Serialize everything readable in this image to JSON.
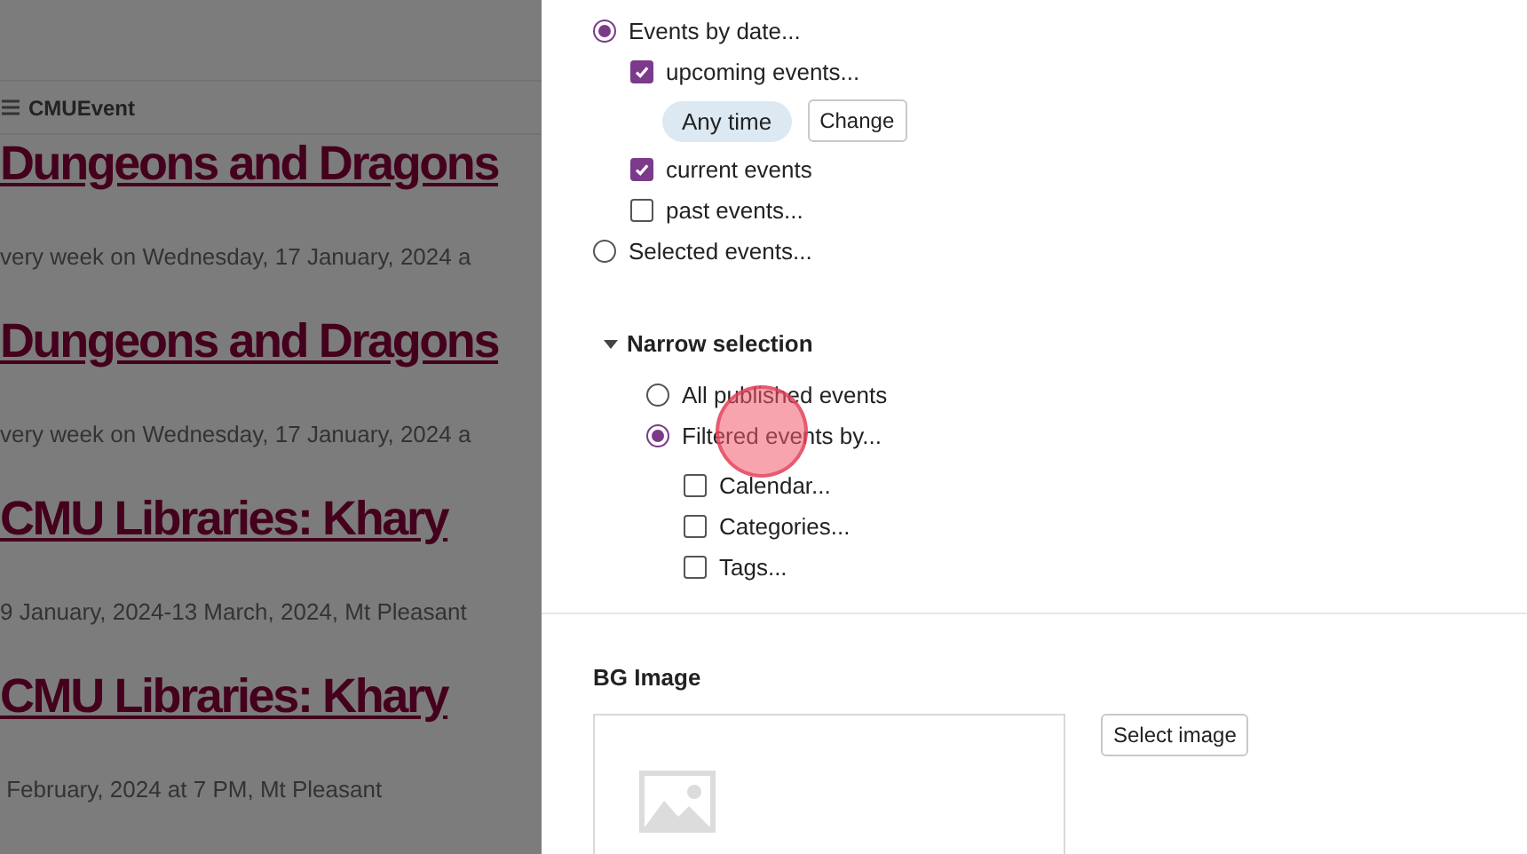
{
  "page": {
    "header": {
      "title": "CMUEvent"
    },
    "events": [
      {
        "title": "Dungeons and Dragons",
        "date": "very week on Wednesday, 17 January, 2024 a"
      },
      {
        "title": "Dungeons and Dragons",
        "date": "very week on Wednesday, 17 January, 2024 a"
      },
      {
        "title": "CMU Libraries: Khary",
        "date": "9 January, 2024-13 March, 2024, Mt Pleasant"
      },
      {
        "title": "CMU Libraries: Khary",
        "date": " February, 2024 at 7 PM, Mt Pleasant"
      }
    ]
  },
  "panel": {
    "event_source": [
      {
        "label": "Events by date...",
        "selected": true,
        "children": [
          {
            "kind": "checkbox",
            "label": "upcoming events...",
            "checked": true
          },
          {
            "kind": "range",
            "chip": "Any time",
            "button": "Change"
          },
          {
            "kind": "checkbox",
            "label": "current events",
            "checked": true
          },
          {
            "kind": "checkbox",
            "label": "past events...",
            "checked": false
          }
        ]
      },
      {
        "label": "Selected events...",
        "selected": false
      }
    ],
    "narrow_selection": {
      "label": "Narrow selection",
      "expanded": true,
      "options": [
        {
          "label": "All published events",
          "selected": false
        },
        {
          "label": "Filtered events by...",
          "selected": true,
          "filters": [
            {
              "label": "Calendar...",
              "checked": false
            },
            {
              "label": "Categories...",
              "checked": false
            },
            {
              "label": "Tags...",
              "checked": false
            }
          ]
        }
      ]
    },
    "bg_image": {
      "label": "BG Image",
      "button": "Select image"
    }
  }
}
